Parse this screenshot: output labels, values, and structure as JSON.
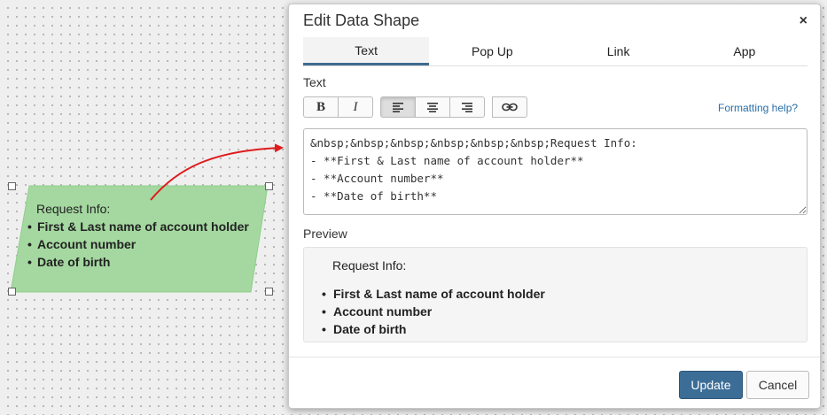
{
  "canvas": {
    "shape": {
      "title": "Request Info:",
      "items": [
        "First & Last name of account holder",
        "Account number",
        "Date of birth"
      ],
      "fill": "#a4d8a0"
    },
    "arrow_color": "#e01b1b"
  },
  "dialog": {
    "title": "Edit Data Shape",
    "close_glyph": "×",
    "tabs": [
      {
        "label": "Text",
        "active": true
      },
      {
        "label": "Pop Up",
        "active": false
      },
      {
        "label": "Link",
        "active": false
      },
      {
        "label": "App",
        "active": false
      }
    ],
    "text_section_label": "Text",
    "toolbar": {
      "bold_glyph": "B",
      "italic_glyph": "I",
      "align_left_icon": "align-left-icon",
      "align_center_icon": "align-center-icon",
      "align_right_icon": "align-right-icon",
      "link_icon": "link-icon",
      "active_button": "align-left"
    },
    "formatting_help": "Formatting help?",
    "editor_value": "&nbsp;&nbsp;&nbsp;&nbsp;&nbsp;&nbsp;Request Info:\n- **First & Last name of account holder**\n- **Account number**\n- **Date of birth**",
    "preview_label": "Preview",
    "preview": {
      "title": "Request Info:",
      "items": [
        "First & Last name of account holder",
        "Account number",
        "Date of birth"
      ]
    },
    "buttons": {
      "update": "Update",
      "cancel": "Cancel"
    },
    "colors": {
      "primary": "#3c6d96",
      "link": "#2a6fa8",
      "tab_underline": "#3e6b8e"
    }
  }
}
